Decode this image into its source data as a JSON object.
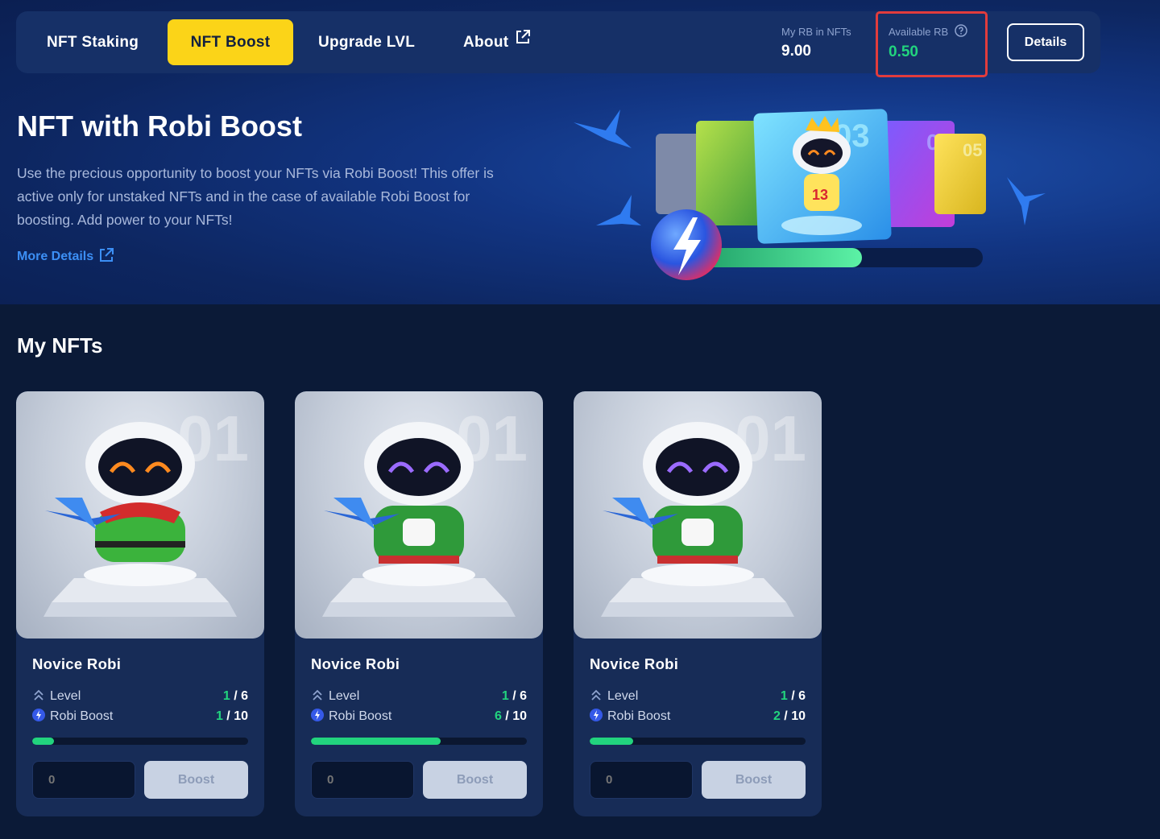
{
  "nav": {
    "tabs": [
      {
        "label": "NFT Staking",
        "active": false
      },
      {
        "label": "NFT Boost",
        "active": true
      },
      {
        "label": "Upgrade LVL",
        "active": false
      },
      {
        "label": "About",
        "active": false,
        "external": true
      }
    ],
    "stats": {
      "my_rb_label": "My RB in NFTs",
      "my_rb_value": "9.00",
      "available_label": "Available RB",
      "available_value": "0.50"
    },
    "details_label": "Details"
  },
  "hero": {
    "title": "NFT with Robi Boost",
    "description": "Use the precious opportunity to boost your NFTs via Robi Boost! This offer is active only for unstaked NFTs and in the case of available Robi Boost for boosting. Add power to your NFTs!",
    "more_details": "More Details",
    "art_card_numbers": [
      "03",
      "04",
      "05"
    ],
    "art_jersey_number": "13"
  },
  "my_nfts": {
    "title": "My NFTs",
    "cards": [
      {
        "name": "Novice Robi",
        "image_number": "01",
        "eye_color": "#ff8a1f",
        "sweater": "elf",
        "level_label": "Level",
        "level_current": "1",
        "level_max": "6",
        "boost_label": "Robi Boost",
        "boost_current": "1",
        "boost_max": "10",
        "boost_progress": 0.1,
        "amount_placeholder": "0",
        "boost_button": "Boost"
      },
      {
        "name": "Novice Robi",
        "image_number": "01",
        "eye_color": "#9b6bff",
        "sweater": "xmas",
        "level_label": "Level",
        "level_current": "1",
        "level_max": "6",
        "boost_label": "Robi Boost",
        "boost_current": "6",
        "boost_max": "10",
        "boost_progress": 0.6,
        "amount_placeholder": "0",
        "boost_button": "Boost"
      },
      {
        "name": "Novice Robi",
        "image_number": "01",
        "eye_color": "#9b6bff",
        "sweater": "xmas",
        "level_label": "Level",
        "level_current": "1",
        "level_max": "6",
        "boost_label": "Robi Boost",
        "boost_current": "2",
        "boost_max": "10",
        "boost_progress": 0.2,
        "amount_placeholder": "0",
        "boost_button": "Boost"
      }
    ]
  },
  "colors": {
    "accent_yellow": "#fbd418",
    "accent_green": "#22d47e",
    "link_blue": "#3c8ff5",
    "highlight_red": "#e13c3c"
  }
}
